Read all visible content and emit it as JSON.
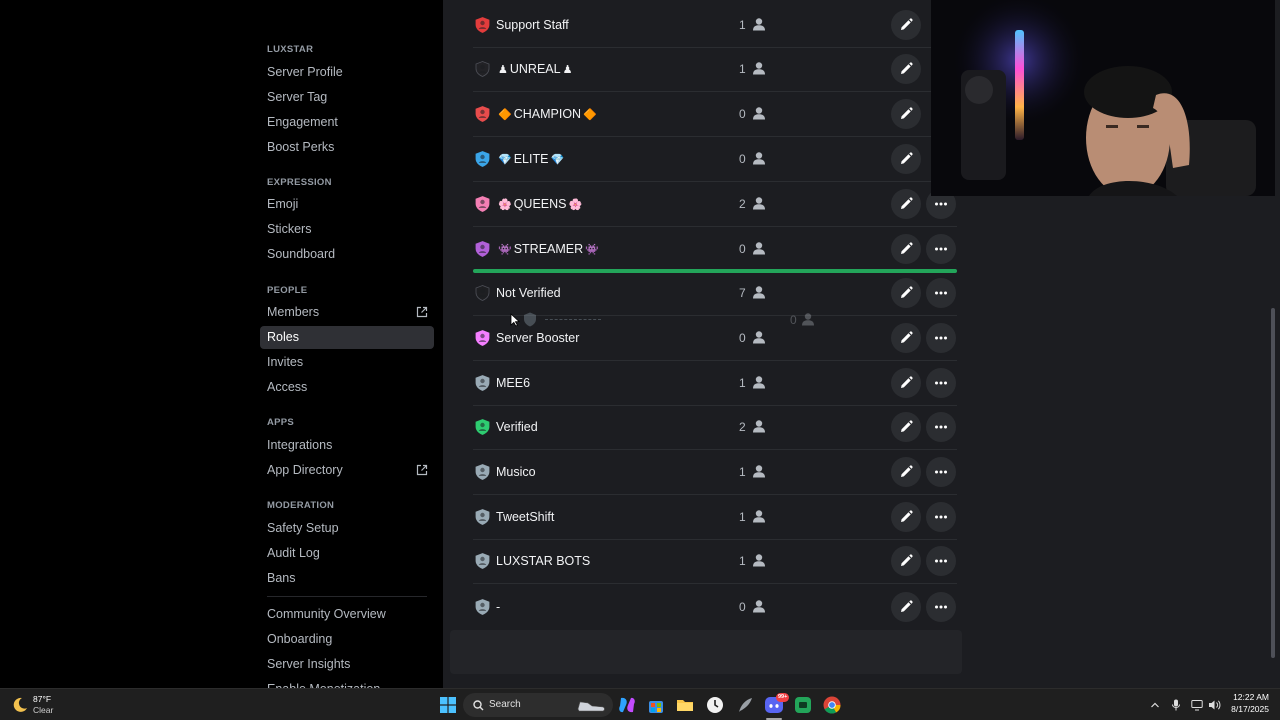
{
  "sidebar": {
    "sections": [
      {
        "header": "LUXSTAR",
        "items": [
          {
            "label": "Server Profile"
          },
          {
            "label": "Server Tag"
          },
          {
            "label": "Engagement"
          },
          {
            "label": "Boost Perks"
          }
        ]
      },
      {
        "header": "EXPRESSION",
        "items": [
          {
            "label": "Emoji"
          },
          {
            "label": "Stickers"
          },
          {
            "label": "Soundboard"
          }
        ]
      },
      {
        "header": "PEOPLE",
        "items": [
          {
            "label": "Members",
            "icon": "external-link-icon"
          },
          {
            "label": "Roles",
            "active": true
          },
          {
            "label": "Invites"
          },
          {
            "label": "Access"
          }
        ]
      },
      {
        "header": "APPS",
        "items": [
          {
            "label": "Integrations"
          },
          {
            "label": "App Directory",
            "icon": "external-link-icon"
          }
        ]
      },
      {
        "header": "MODERATION",
        "items": [
          {
            "label": "Safety Setup"
          },
          {
            "label": "Audit Log"
          },
          {
            "label": "Bans"
          }
        ]
      },
      {
        "header": "",
        "items": [
          {
            "label": "Community Overview"
          },
          {
            "label": "Onboarding"
          },
          {
            "label": "Server Insights"
          },
          {
            "label": "Enable Monetization"
          }
        ]
      }
    ]
  },
  "roles": [
    {
      "name": "Support Staff",
      "count": "1",
      "color": "#e23c3c",
      "emoji_before": "",
      "emoji_after": ""
    },
    {
      "name": "UNREAL",
      "count": "1",
      "color": "#222226",
      "emoji_before": "♟",
      "emoji_after": "♟"
    },
    {
      "name": "CHAMPION",
      "count": "0",
      "color": "#e84c4c",
      "emoji_before": "🔶",
      "emoji_after": "🔶"
    },
    {
      "name": "ELITE",
      "count": "0",
      "color": "#3ba5e8",
      "emoji_before": "💎",
      "emoji_after": "💎"
    },
    {
      "name": "QUEENS",
      "count": "2",
      "color": "#f47fb4",
      "emoji_before": "🌸",
      "emoji_after": "🌸"
    },
    {
      "name": "STREAMER",
      "count": "0",
      "color": "#b160d8",
      "emoji_before": "👾",
      "emoji_after": "👾"
    },
    {
      "name": "Not Verified",
      "count": "7",
      "color": "#1e1f22",
      "emoji_before": "",
      "emoji_after": ""
    },
    {
      "name": "Server Booster",
      "count": "0",
      "color": "#f47fff",
      "emoji_before": "",
      "emoji_after": ""
    },
    {
      "name": "MEE6",
      "count": "1",
      "color": "#99aab5",
      "emoji_before": "",
      "emoji_after": ""
    },
    {
      "name": "Verified",
      "count": "2",
      "color": "#2ecc71",
      "emoji_before": "",
      "emoji_after": ""
    },
    {
      "name": "Musico",
      "count": "1",
      "color": "#99aab5",
      "emoji_before": "",
      "emoji_after": ""
    },
    {
      "name": "TweetShift",
      "count": "1",
      "color": "#99aab5",
      "emoji_before": "",
      "emoji_after": ""
    },
    {
      "name": "LUXSTAR BOTS",
      "count": "1",
      "color": "#99aab5",
      "emoji_before": "",
      "emoji_after": ""
    },
    {
      "name": "-",
      "count": "0",
      "color": "#99aab5",
      "emoji_before": "",
      "emoji_after": ""
    }
  ],
  "drag_ghost": {
    "count": "0"
  },
  "taskbar": {
    "weather": {
      "temp": "87°F",
      "condition": "Clear"
    },
    "search_label": "Search",
    "clock": {
      "time": "12:22 AM",
      "date": "8/17/2025"
    },
    "discord_badge": "99+"
  },
  "colors": {
    "accent_green": "#23a55a",
    "background": "#1c1d21"
  }
}
